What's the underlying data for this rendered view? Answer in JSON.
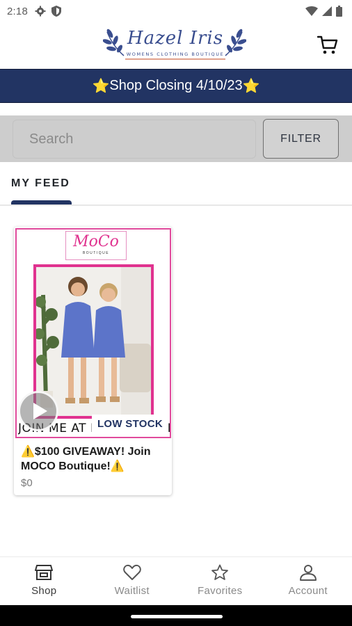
{
  "status_bar": {
    "time": "2:18"
  },
  "header": {
    "logo_title": "Hazel Iris",
    "logo_subtitle": "WOMENS CLOTHING BOUTIQUE"
  },
  "banner": {
    "text": "Shop Closing 4/10/23",
    "star": "⭐"
  },
  "search": {
    "placeholder": "Search",
    "filter_label": "FILTER"
  },
  "feed": {
    "tab_label": "MY FEED"
  },
  "products": [
    {
      "image_brand": "MoCo",
      "image_brand_sub": "BOUTIQUE",
      "image_caption": "JOIN ME AT MOCO BOUTIQUE!",
      "badge": "LOW STOCK",
      "title": "⚠️$100 GIVEAWAY! Join MOCO Boutique!⚠️",
      "price": "$0"
    }
  ],
  "bottom_nav": {
    "items": [
      {
        "label": "Shop",
        "icon": "shop-icon"
      },
      {
        "label": "Waitlist",
        "icon": "heart-icon"
      },
      {
        "label": "Favorites",
        "icon": "star-icon"
      },
      {
        "label": "Account",
        "icon": "person-icon"
      }
    ]
  },
  "colors": {
    "navy": "#223463",
    "star": "#f9c418",
    "brand_pink": "#e0328f",
    "search_bg": "#cdcdcd"
  }
}
